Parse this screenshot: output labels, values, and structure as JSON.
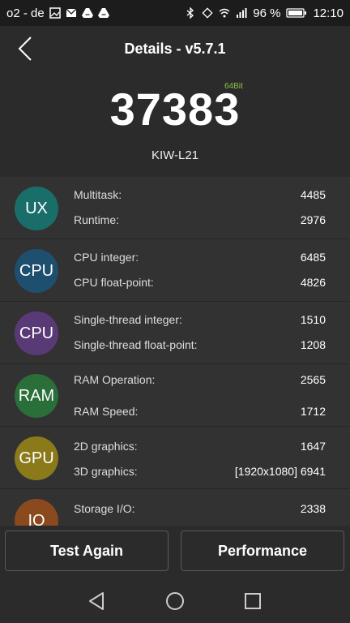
{
  "status_bar": {
    "carrier": "o2 - de",
    "battery_percent": "96 %",
    "time": "12:10",
    "left_icons": [
      "image-icon",
      "mail-icon",
      "drive-icon",
      "drive-icon"
    ],
    "right_icons": [
      "bluetooth-icon",
      "rotate-icon",
      "wifi-icon",
      "signal-icon",
      "battery-icon"
    ]
  },
  "header": {
    "title": "Details - v5.7.1"
  },
  "score": {
    "value": "37383",
    "bit_label": "64Bit",
    "model": "KIW-L21"
  },
  "categories": [
    {
      "badge": "UX",
      "color": "#1a6e6a",
      "items": [
        {
          "label": "Multitask:",
          "value": "4485"
        },
        {
          "label": "Runtime:",
          "value": "2976"
        }
      ]
    },
    {
      "badge": "CPU",
      "color": "#1f4f6e",
      "items": [
        {
          "label": "CPU integer:",
          "value": "6485"
        },
        {
          "label": "CPU float-point:",
          "value": "4826"
        }
      ]
    },
    {
      "badge": "CPU",
      "color": "#5a3a76",
      "items": [
        {
          "label": "Single-thread integer:",
          "value": "1510"
        },
        {
          "label": "Single-thread float-point:",
          "value": "1208"
        }
      ]
    },
    {
      "badge": "RAM",
      "color": "#2a6e3a",
      "items": [
        {
          "label": "RAM Operation:",
          "value": "2565"
        },
        {
          "label": "RAM Speed:",
          "value": "1712"
        }
      ]
    },
    {
      "badge": "GPU",
      "color": "#8a7a1a",
      "items": [
        {
          "label": "2D graphics:",
          "value": "1647"
        },
        {
          "label": "3D graphics:",
          "value": "[1920x1080] 6941"
        }
      ]
    },
    {
      "badge": "IO",
      "color": "#8a4a1e",
      "items": [
        {
          "label": "Storage I/O:",
          "value": "2338"
        }
      ]
    }
  ],
  "buttons": {
    "test_again": "Test Again",
    "performance": "Performance"
  },
  "nav_icons": [
    "back-nav-icon",
    "home-nav-icon",
    "recents-nav-icon"
  ]
}
